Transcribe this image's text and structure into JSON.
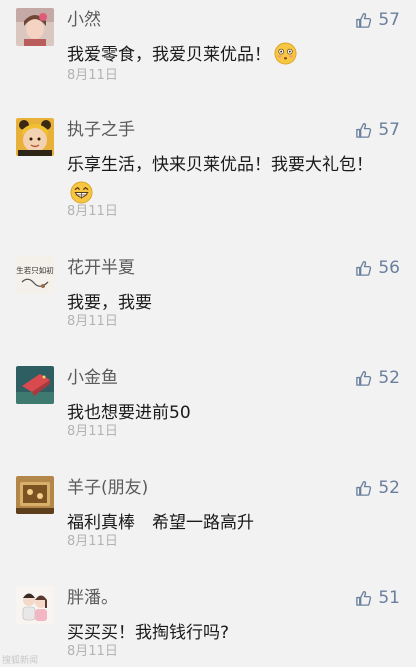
{
  "comments": [
    {
      "name": "小然",
      "likes": "57",
      "text": "我爱零食，我爱贝莱优品！",
      "emoji": "blushing-face",
      "date": "8月11日"
    },
    {
      "name": "执子之手",
      "likes": "57",
      "text": "乐享生活，快来贝莱优品！我要大礼包！",
      "emoji": "grinning-face",
      "date": "8月11日"
    },
    {
      "name": "花开半夏",
      "likes": "56",
      "text": "我要，我要",
      "date": "8月11日",
      "avatar_text": "人生若只如初见"
    },
    {
      "name": "小金鱼",
      "likes": "52",
      "text": "我也想要进前50",
      "date": "8月11日"
    },
    {
      "name": "羊子(朋友)",
      "likes": "52",
      "text": "福利真棒　希望一路高升",
      "date": "8月11日"
    },
    {
      "name": "胖潘。",
      "likes": "51",
      "text": "买买买！我掏钱行吗?",
      "date": "8月11日"
    }
  ],
  "watermark": "搜狐新闻",
  "icons": {
    "like": "thumbs-up-icon"
  },
  "colors": {
    "like": "#6a7f9d",
    "name": "#5b5b5b",
    "date": "#b3b3b3",
    "background": "#f2f2f2"
  }
}
